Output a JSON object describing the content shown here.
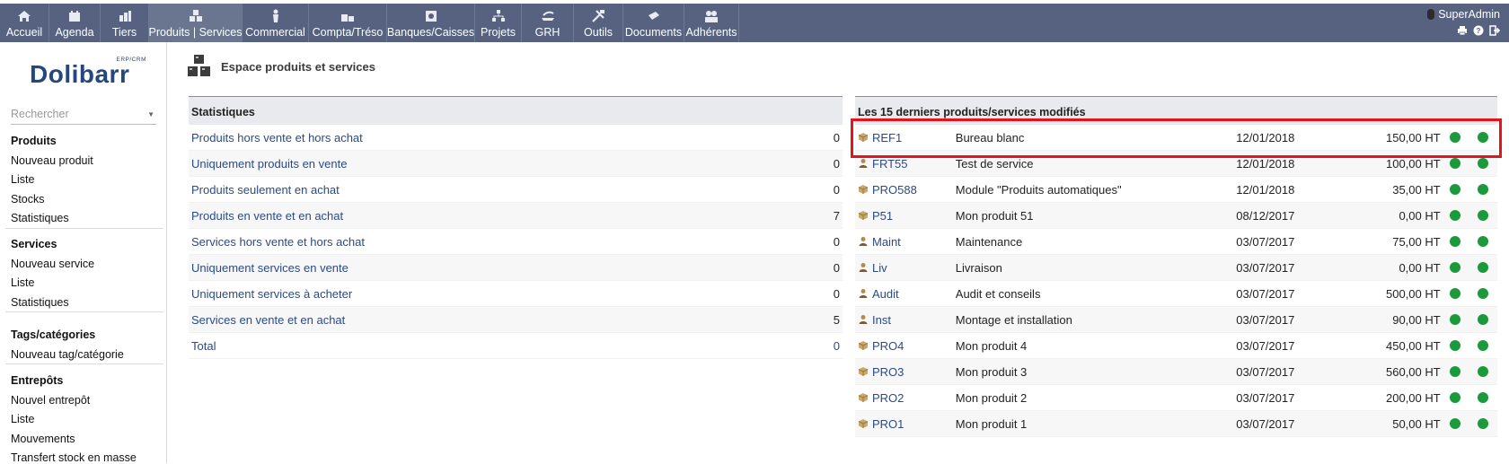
{
  "topmenu": {
    "items": [
      {
        "label": "Accueil",
        "icon": "home-icon"
      },
      {
        "label": "Agenda",
        "icon": "calendar-icon"
      },
      {
        "label": "Tiers",
        "icon": "company-icon"
      },
      {
        "label": "Produits | Services",
        "icon": "products-icon"
      },
      {
        "label": "Commercial",
        "icon": "commercial-icon"
      },
      {
        "label": "Compta/Tréso",
        "icon": "accounting-icon"
      },
      {
        "label": "Banques/Caisses",
        "icon": "bank-icon"
      },
      {
        "label": "Projets",
        "icon": "projects-icon"
      },
      {
        "label": "GRH",
        "icon": "hr-icon"
      },
      {
        "label": "Outils",
        "icon": "tools-icon"
      },
      {
        "label": "Documents",
        "icon": "documents-icon"
      },
      {
        "label": "Adhérents",
        "icon": "members-icon"
      }
    ],
    "active_index": 3,
    "user": "SuperAdmin",
    "colors": {
      "bar": "#56627f",
      "active": "#6a7590"
    }
  },
  "sidebar": {
    "logo_text": "Dolibarr",
    "logo_sub": "ERP/CRM",
    "search_placeholder": "Rechercher",
    "groups": [
      {
        "title": "Produits",
        "items": [
          "Nouveau produit",
          "Liste",
          "Stocks",
          "Statistiques"
        ]
      },
      {
        "title": "Services",
        "items": [
          "Nouveau service",
          "Liste",
          "Statistiques"
        ]
      },
      {
        "title": "Tags/catégories",
        "items": [
          "Nouveau tag/catégorie"
        ]
      },
      {
        "title": "Entrepôts",
        "items": [
          "Nouvel entrepôt",
          "Liste",
          "Mouvements",
          "Transfert stock en masse"
        ]
      }
    ]
  },
  "page": {
    "title": "Espace produits et services"
  },
  "stats": {
    "header": "Statistiques",
    "rows": [
      {
        "label": "Produits hors vente et hors achat",
        "value": "0"
      },
      {
        "label": "Uniquement produits en vente",
        "value": "0"
      },
      {
        "label": "Produits seulement en achat",
        "value": "0"
      },
      {
        "label": "Produits en vente et en achat",
        "value": "7"
      },
      {
        "label": "Services hors vente et hors achat",
        "value": "0"
      },
      {
        "label": "Uniquement services en vente",
        "value": "0"
      },
      {
        "label": "Uniquement services à acheter",
        "value": "0"
      },
      {
        "label": "Services en vente et en achat",
        "value": "5"
      }
    ],
    "total_label": "Total",
    "total_value": "0"
  },
  "latest": {
    "header": "Les 15 derniers produits/services modifiés",
    "status_color": "#1a9a3a",
    "rows": [
      {
        "ref": "REF1",
        "kind": "product",
        "name": "Bureau blanc",
        "date": "12/01/2018",
        "price": "150,00 HT"
      },
      {
        "ref": "FRT55",
        "kind": "service",
        "name": "Test de service",
        "date": "12/01/2018",
        "price": "100,00 HT"
      },
      {
        "ref": "PRO588",
        "kind": "product",
        "name": "Module \"Produits automatiques\"",
        "date": "12/01/2018",
        "price": "35,00 HT"
      },
      {
        "ref": "P51",
        "kind": "product",
        "name": "Mon produit 51",
        "date": "08/12/2017",
        "price": "0,00 HT"
      },
      {
        "ref": "Maint",
        "kind": "service",
        "name": "Maintenance",
        "date": "03/07/2017",
        "price": "75,00 HT"
      },
      {
        "ref": "Liv",
        "kind": "service",
        "name": "Livraison",
        "date": "03/07/2017",
        "price": "0,00 HT"
      },
      {
        "ref": "Audit",
        "kind": "service",
        "name": "Audit et conseils",
        "date": "03/07/2017",
        "price": "500,00 HT"
      },
      {
        "ref": "Inst",
        "kind": "service",
        "name": "Montage et installation",
        "date": "03/07/2017",
        "price": "90,00 HT"
      },
      {
        "ref": "PRO4",
        "kind": "product",
        "name": "Mon produit 4",
        "date": "03/07/2017",
        "price": "450,00 HT"
      },
      {
        "ref": "PRO3",
        "kind": "product",
        "name": "Mon produit 3",
        "date": "03/07/2017",
        "price": "560,00 HT"
      },
      {
        "ref": "PRO2",
        "kind": "product",
        "name": "Mon produit 2",
        "date": "03/07/2017",
        "price": "200,00 HT"
      },
      {
        "ref": "PRO1",
        "kind": "product",
        "name": "Mon produit 1",
        "date": "03/07/2017",
        "price": "50,00 HT"
      }
    ]
  },
  "highlight": {
    "color": "#e3151b"
  }
}
